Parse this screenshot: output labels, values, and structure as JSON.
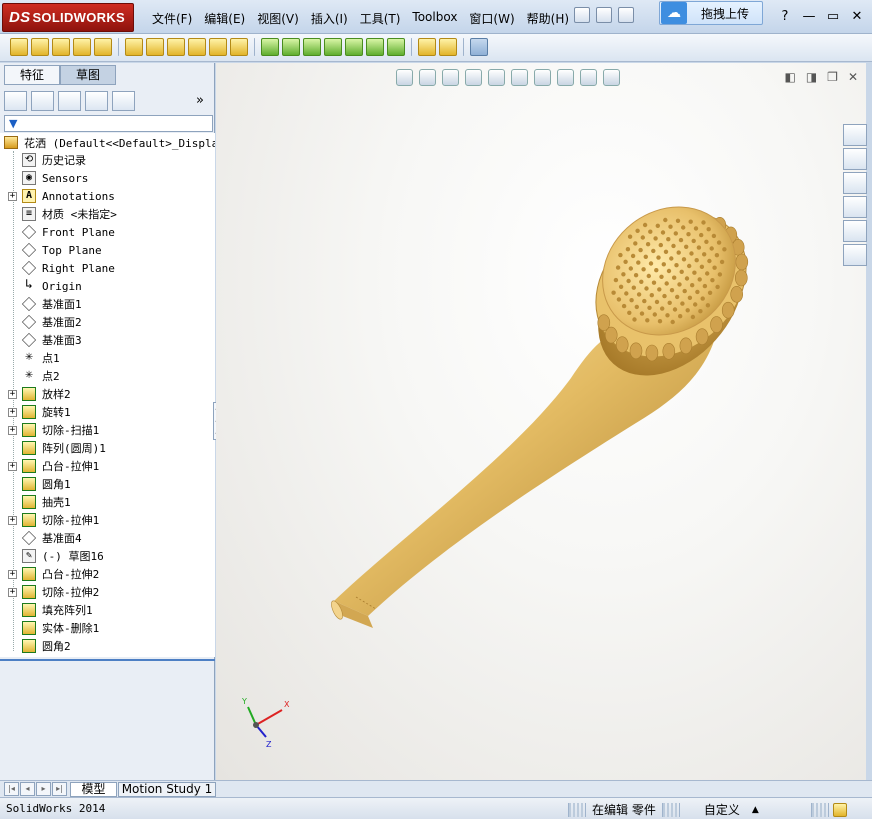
{
  "app": {
    "logo_text": "SOLIDWORKS",
    "logo_mark": "DS"
  },
  "menu": {
    "items": [
      "文件(F)",
      "编辑(E)",
      "视图(V)",
      "插入(I)",
      "工具(T)",
      "Toolbox",
      "窗口(W)",
      "帮助(H)"
    ],
    "upload_label": "拖拽上传",
    "help_glyph": "?"
  },
  "feature_manager": {
    "tabs": [
      "特征",
      "草图"
    ],
    "expand_glyph": "»",
    "root_label": "花洒  (Default<<Default>_Display",
    "items": [
      {
        "label": "历史记录",
        "expandable": false,
        "icon": "history-icon"
      },
      {
        "label": "Sensors",
        "expandable": false,
        "icon": "sensor-icon"
      },
      {
        "label": "Annotations",
        "expandable": true,
        "icon": "annotation-icon"
      },
      {
        "label": "材质 <未指定>",
        "expandable": false,
        "icon": "material-icon"
      },
      {
        "label": "Front Plane",
        "expandable": false,
        "icon": "plane-icon"
      },
      {
        "label": "Top Plane",
        "expandable": false,
        "icon": "plane-icon"
      },
      {
        "label": "Right Plane",
        "expandable": false,
        "icon": "plane-icon"
      },
      {
        "label": "Origin",
        "expandable": false,
        "icon": "origin-icon"
      },
      {
        "label": "基准面1",
        "expandable": false,
        "icon": "plane-icon"
      },
      {
        "label": "基准面2",
        "expandable": false,
        "icon": "plane-icon"
      },
      {
        "label": "基准面3",
        "expandable": false,
        "icon": "plane-icon"
      },
      {
        "label": "点1",
        "expandable": false,
        "icon": "point-icon"
      },
      {
        "label": "点2",
        "expandable": false,
        "icon": "point-icon"
      },
      {
        "label": "放样2",
        "expandable": true,
        "icon": "loft-icon"
      },
      {
        "label": "旋转1",
        "expandable": true,
        "icon": "revolve-icon"
      },
      {
        "label": "切除-扫描1",
        "expandable": true,
        "icon": "sweep-cut-icon"
      },
      {
        "label": "阵列(圆周)1",
        "expandable": false,
        "icon": "circular-pattern-icon"
      },
      {
        "label": "凸台-拉伸1",
        "expandable": true,
        "icon": "boss-extrude-icon"
      },
      {
        "label": "圆角1",
        "expandable": false,
        "icon": "fillet-icon"
      },
      {
        "label": "抽壳1",
        "expandable": false,
        "icon": "shell-icon"
      },
      {
        "label": "切除-拉伸1",
        "expandable": true,
        "icon": "cut-extrude-icon"
      },
      {
        "label": "基准面4",
        "expandable": false,
        "icon": "plane-icon"
      },
      {
        "label": "(-) 草图16",
        "expandable": false,
        "icon": "sketch-icon"
      },
      {
        "label": "凸台-拉伸2",
        "expandable": true,
        "icon": "boss-extrude-icon"
      },
      {
        "label": "切除-拉伸2",
        "expandable": true,
        "icon": "cut-extrude-icon"
      },
      {
        "label": "填充阵列1",
        "expandable": false,
        "icon": "fill-pattern-icon"
      },
      {
        "label": "实体-删除1",
        "expandable": false,
        "icon": "delete-body-icon"
      },
      {
        "label": "圆角2",
        "expandable": false,
        "icon": "fillet-icon"
      }
    ]
  },
  "triad": {
    "x": "X",
    "y": "Y",
    "z": "Z"
  },
  "bottom_tabs": [
    "模型",
    "Motion Study 1"
  ],
  "status": {
    "app_version": "SolidWorks 2014",
    "mode": "在编辑  零件",
    "units": "自定义",
    "units_arrow": "▲"
  },
  "colors": {
    "model": "#d9b15c",
    "logo_red": "#b8231a",
    "selection_blue": "#4d7fc4"
  }
}
